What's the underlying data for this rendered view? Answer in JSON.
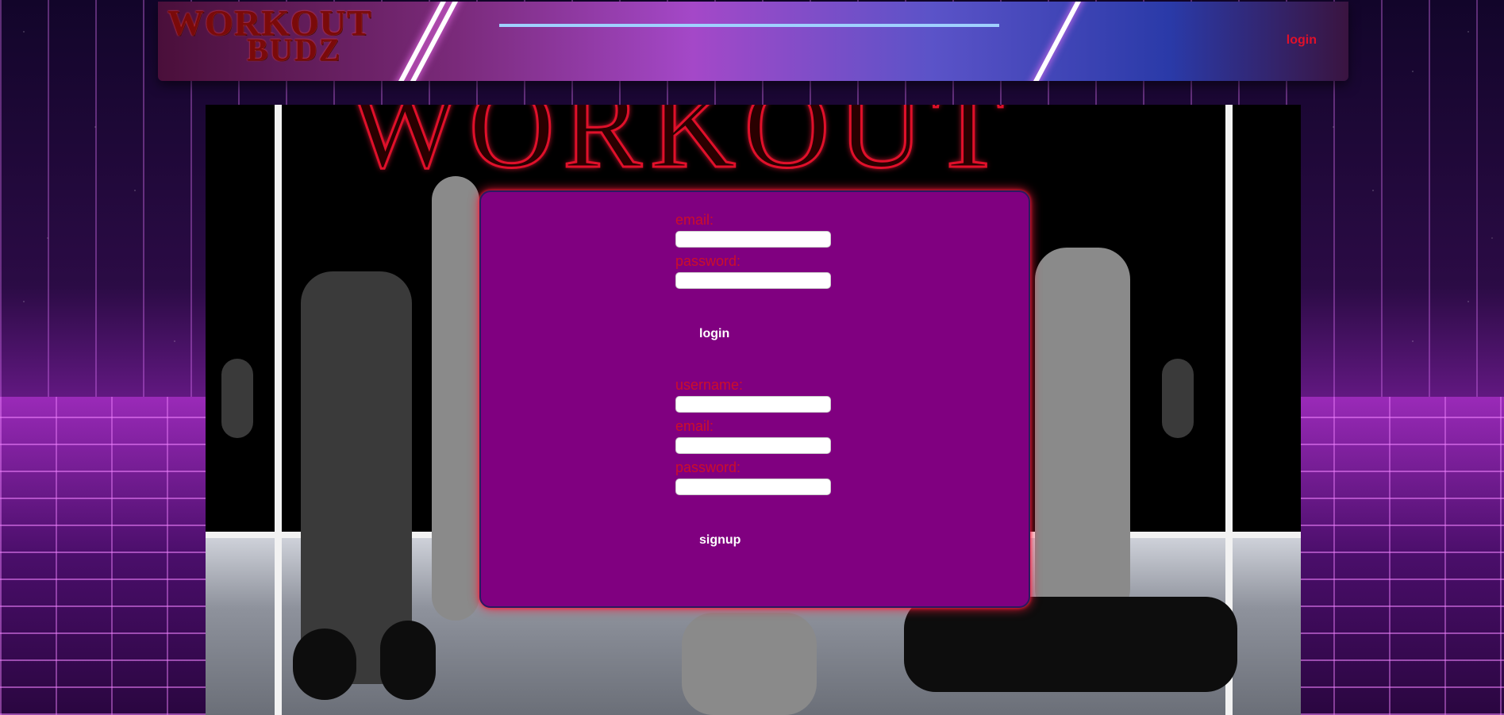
{
  "header": {
    "logo_line1": "WORKOUT",
    "logo_line2": "BUDZ",
    "nav_login_label": "login"
  },
  "hero": {
    "title": "WORKOUT"
  },
  "login_form": {
    "email_label": "email:",
    "password_label": "password:",
    "submit_label": "login"
  },
  "signup_form": {
    "username_label": "username:",
    "email_label": "email:",
    "password_label": "password:",
    "submit_label": "signup"
  },
  "colors": {
    "panel": "#800080",
    "label_red": "#cc0e2a",
    "nav_red": "#e0102a"
  }
}
